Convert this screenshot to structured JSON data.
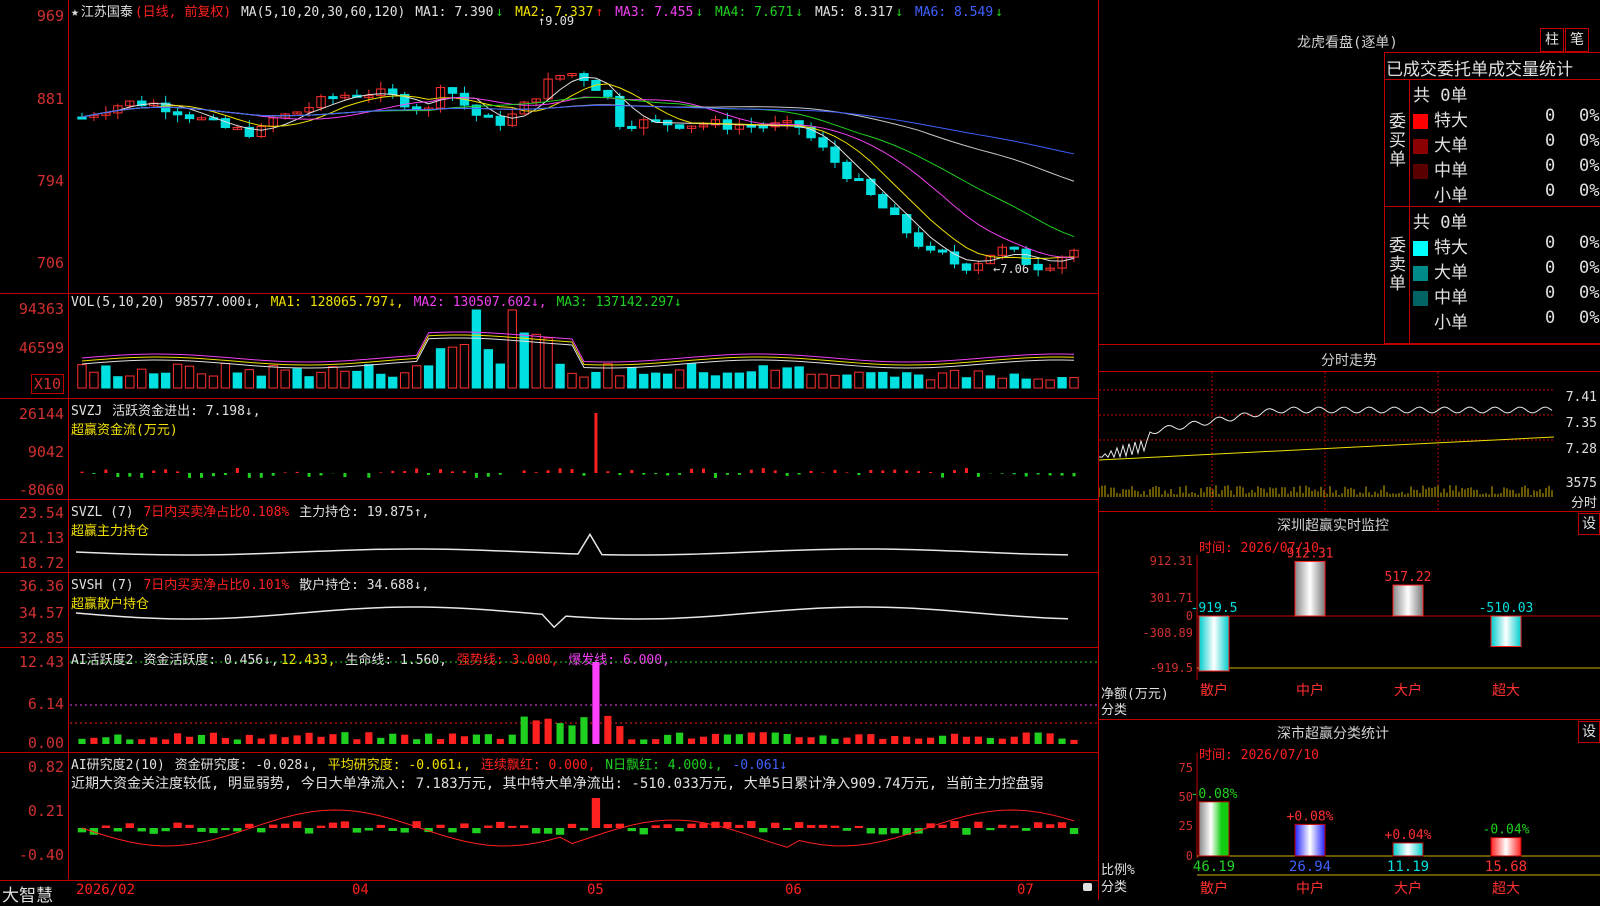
{
  "stock": {
    "name": "江苏国泰",
    "mode": "(日线, 前复权)"
  },
  "kline": {
    "title": "MA(5,10,20,30,60,120)",
    "ma": [
      {
        "label": "MA1: 7.390",
        "arrow": "↓",
        "color": "#e0e0e0"
      },
      {
        "label": "MA2: 7.337",
        "arrow": "↑",
        "color": "#f0e000"
      },
      {
        "label": "MA3: 7.455",
        "arrow": "↓",
        "color": "#f040f0"
      },
      {
        "label": "MA4: 7.671",
        "arrow": "↓",
        "color": "#20d020"
      },
      {
        "label": "MA5: 8.317",
        "arrow": "↓",
        "color": "#c8c8c8"
      },
      {
        "label": "MA6: 8.549",
        "arrow": "↓",
        "color": "#4060ff"
      }
    ],
    "yticks": [
      "969",
      "881",
      "794",
      "706"
    ],
    "high_mark": "9.09",
    "low_mark": "7.06"
  },
  "volume": {
    "title": "VOL(5,10,20)",
    "value": "98577.000↓,",
    "ma1": "MA1: 128065.797↓,",
    "ma2": "MA2: 130507.602↓,",
    "ma3": "MA3: 137142.297↓",
    "yticks": [
      "94363",
      "46599"
    ],
    "unit": "X10"
  },
  "svzj": {
    "title": "SVZJ",
    "label": "活跃资金进出: 7.198↓,",
    "subtitle": "超赢资金流(万元)",
    "yticks": [
      "26144",
      "9042",
      "-8060"
    ]
  },
  "svzl": {
    "title": "SVZL (7)",
    "label1": "7日内买卖净占比0.108%",
    "label2": "主力持仓: 19.875↑,",
    "subtitle": "超赢主力持仓",
    "yticks": [
      "23.54",
      "21.13",
      "18.72"
    ]
  },
  "svsh": {
    "title": "SVSH (7)",
    "label1": "7日内买卖净占比0.101%",
    "label2": "散户持仓: 34.688↓,",
    "subtitle": "超赢散户持仓",
    "yticks": [
      "36.36",
      "34.57",
      "32.85"
    ]
  },
  "ai1": {
    "title": "AI活跃度2",
    "l1": "资金活跃度: 0.456↓,",
    "l2": "12.433,",
    "l3": "生命线: 1.560,",
    "l4": "强势线: 3.000,",
    "l5": "爆发线: 6.000,",
    "yticks": [
      "12.43",
      "6.14",
      "0.00"
    ]
  },
  "ai2": {
    "title": "AI研究度2(10)",
    "l1": "资金研究度: -0.028↓,",
    "l2": "平均研究度: -0.061↓,",
    "l3": "连续飘红: 0.000,",
    "l4": "N日飘红: 4.000↓,",
    "l5": "-0.061↓",
    "comment": "近期大资金关注度较低, 明显弱势, 今日大单净流入: 7.183万元, 其中特大单净流出: -510.033万元, 大单5日累计净入909.74万元, 当前主力控盘弱",
    "yticks": [
      "0.82",
      "0.21",
      "-0.40"
    ]
  },
  "footer": {
    "brand": "大智慧",
    "dates": [
      "2026/02",
      "04",
      "05",
      "06",
      "07"
    ]
  },
  "dragon": {
    "title": "龙虎看盘(逐单)",
    "btn1": "柱",
    "btn2": "笔",
    "header": "已成交委托单成交量统计",
    "buy_label": "委买单",
    "sell_label": "委卖单",
    "buy_total": "共 0单",
    "sell_total": "共 0单",
    "buy_rows": [
      {
        "label": "特大",
        "val": "0",
        "pct": "0%",
        "color": "#ff0000"
      },
      {
        "label": "大单",
        "val": "0",
        "pct": "0%",
        "color": "#8b0000"
      },
      {
        "label": "中单",
        "val": "0",
        "pct": "0%",
        "color": "#5a0000"
      },
      {
        "label": "小单",
        "val": "0",
        "pct": "0%",
        "color": "#000000"
      }
    ],
    "sell_rows": [
      {
        "label": "特大",
        "val": "0",
        "pct": "0%",
        "color": "#00ffff"
      },
      {
        "label": "大单",
        "val": "0",
        "pct": "0%",
        "color": "#008b8b"
      },
      {
        "label": "中单",
        "val": "0",
        "pct": "0%",
        "color": "#006464"
      },
      {
        "label": "小单",
        "val": "0",
        "pct": "0%",
        "color": "#000000"
      }
    ]
  },
  "intraday": {
    "title": "分时走势",
    "yticks": [
      "7.41",
      "7.35",
      "7.28",
      "3575"
    ],
    "unit": "分时"
  },
  "sz_monitor": {
    "title": "深圳超赢实时监控",
    "btn": "设",
    "time": "时间: 2026/07/10",
    "yticks": [
      "912.31",
      "301.71",
      "0",
      "-308.89",
      "-919.5"
    ],
    "ylabel1": "净额(万元)",
    "ylabel2": "分类",
    "cats": [
      "散户",
      "中户",
      "大户",
      "超大"
    ],
    "values": [
      "-919.5",
      "912.31",
      "517.22",
      "-510.03"
    ]
  },
  "sz_class": {
    "title": "深市超赢分类统计",
    "btn": "设",
    "time": "时间: 2026/07/10",
    "yticks": [
      "75",
      "50",
      "25",
      "0"
    ],
    "ylabel1": "比例%",
    "ylabel2": "分类",
    "cats": [
      "散户",
      "中户",
      "大户",
      "超大"
    ],
    "pcts": [
      "-0.08%",
      "+0.08%",
      "+0.04%",
      "-0.04%"
    ],
    "values": [
      "46.19",
      "26.94",
      "11.19",
      "15.68"
    ]
  },
  "chart_data": [
    {
      "type": "bar",
      "title": "深圳超赢实时监控",
      "categories": [
        "散户",
        "中户",
        "大户",
        "超大"
      ],
      "values": [
        -919.5,
        912.31,
        517.22,
        -510.03
      ],
      "ylabel": "净额(万元)",
      "ylim": [
        -919.5,
        912.31
      ]
    },
    {
      "type": "bar",
      "title": "深市超赢分类统计",
      "categories": [
        "散户",
        "中户",
        "大户",
        "超大"
      ],
      "values": [
        46.19,
        26.94,
        11.19,
        15.68
      ],
      "ylabel": "比例%",
      "ylim": [
        0,
        75
      ]
    }
  ]
}
